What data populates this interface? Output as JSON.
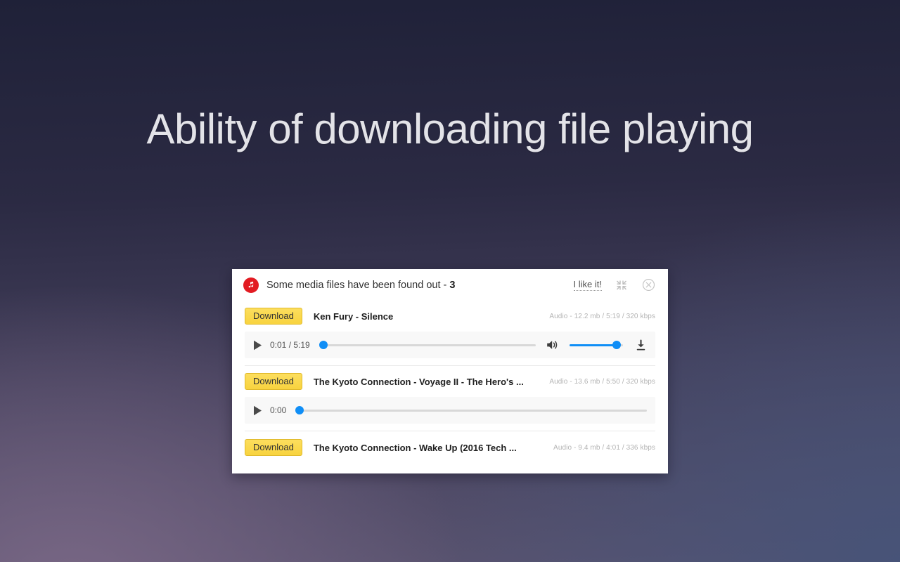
{
  "headline": "Ability of downloading file playing",
  "theme": {
    "accent_blue": "#108ef6",
    "button_yellow": "#fbd93f",
    "badge_red": "#e21b22",
    "panel_bg": "#ffffff",
    "bg_top": "#1f2138",
    "bg_bottom_left": "#7a6886",
    "bg_bottom_right": "#465378"
  },
  "panel": {
    "header": {
      "icon": "music-note-icon",
      "title_text": "Some media files have been found out - ",
      "title_count": "3",
      "like_label": "I like it!",
      "collapse_icon": "collapse-arrows-icon",
      "close_icon": "close-circle-icon"
    },
    "items": [
      {
        "download_label": "Download",
        "title": "Ken Fury - Silence",
        "meta": "Audio - 12.2 mb / 5:19 / 320 kbps",
        "player": {
          "play_icon": "play-icon",
          "time": "0:01 / 5:19",
          "progress_percent": 1,
          "has_volume": true,
          "volume_percent": 88,
          "volume_icon": "volume-icon",
          "download_icon": "download-arrow-icon"
        }
      },
      {
        "download_label": "Download",
        "title": "The Kyoto Connection - Voyage II - The Hero's ...",
        "meta": "Audio - 13.6 mb / 5:50 / 320 kbps",
        "player": {
          "play_icon": "play-icon",
          "time": "0:00",
          "progress_percent": 0,
          "has_volume": false
        }
      },
      {
        "download_label": "Download",
        "title": "The Kyoto Connection - Wake Up (2016 Tech ...",
        "meta": "Audio - 9.4 mb / 4:01 / 336 kbps",
        "player": null
      }
    ]
  }
}
